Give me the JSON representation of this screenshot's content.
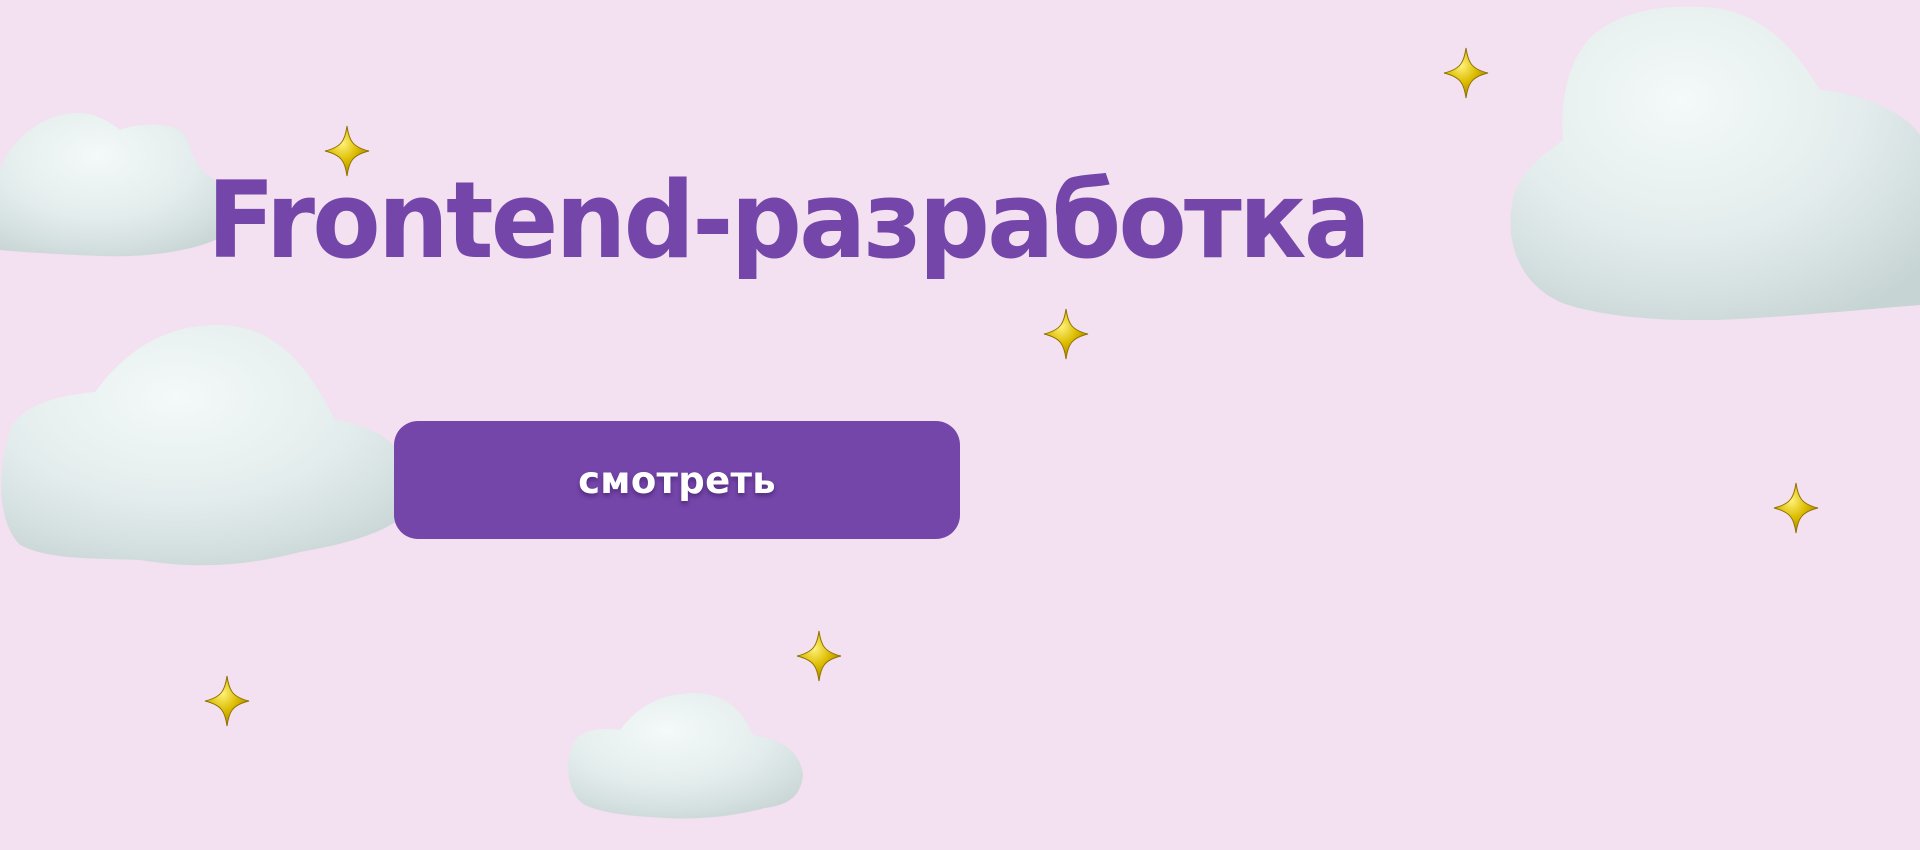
{
  "hero": {
    "title": "Frontend-разработка",
    "watch_button_label": "смотреть"
  },
  "colors": {
    "background": "#f3e0f0",
    "accent": "#7546aa",
    "button_text": "#ffffff",
    "cloud": "#e4eded",
    "sparkle": "#d4b300"
  },
  "decorations": {
    "clouds": [
      "cloud-icon",
      "cloud-icon",
      "cloud-icon",
      "cloud-icon"
    ],
    "sparkles": [
      "sparkle-icon",
      "sparkle-icon",
      "sparkle-icon",
      "sparkle-icon",
      "sparkle-icon",
      "sparkle-icon",
      "sparkle-icon"
    ]
  }
}
